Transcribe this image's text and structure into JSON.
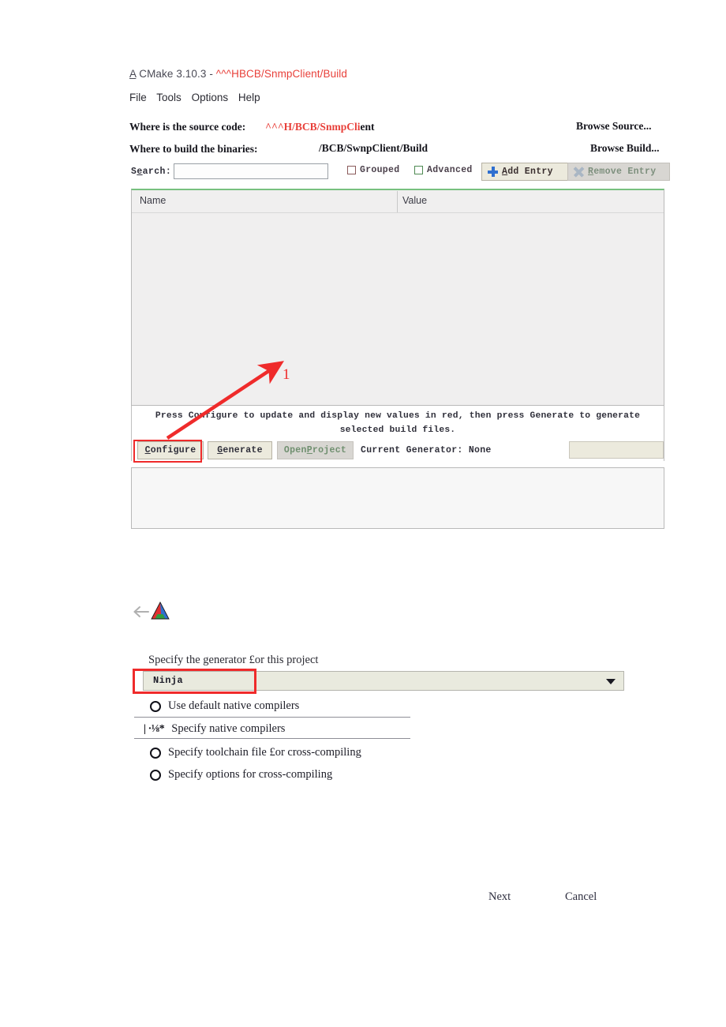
{
  "window": {
    "app_icon": "A",
    "title": "CMake 3.10.3 -",
    "title_path": "^^^HBCB/SnmpClient/Build",
    "menu": [
      "File",
      "Tools",
      "Options",
      "Help"
    ]
  },
  "paths": {
    "source_label": "Where is the source code:",
    "source_value_red": "^^^H/BCB/SnmpCli",
    "source_value_black": "ent",
    "browse_source_label": "Browse Source...",
    "build_label": "Where to build the binaries:",
    "build_value": "/BCB/SwnpClient/Build",
    "browse_build_label": "Browse Build..."
  },
  "toolbar": {
    "search_label": "Search:",
    "search_value": "",
    "search_placeholder": "",
    "grouped_label": "Grouped",
    "grouped_checked": false,
    "advanced_label": "Advanced",
    "advanced_checked": false,
    "add_entry_label_u": "A",
    "add_entry_label_rest": "dd Entry",
    "remove_entry_label_u": "R",
    "remove_entry_label_rest": "emove Entry"
  },
  "cache_table": {
    "columns": [
      "Name",
      "Value"
    ],
    "rows": []
  },
  "hint": {
    "line1": "Press Configure to update and display new values in red, then press Generate to generate selected",
    "line2": "build files."
  },
  "actions": {
    "configure_u": "C",
    "configure_rest": "onfigure",
    "generate_u": "G",
    "generate_rest": "enerate",
    "open_project_a": "Open ",
    "open_project_u": "P",
    "open_project_rest": "roject",
    "current_generator": "Current Generator: None"
  },
  "annotation": {
    "number": "1",
    "arrow_color": "#ef2b2b",
    "highlight_color": "#ef2b2b"
  },
  "wizard": {
    "prompt": "Specify the generator £or this project",
    "generator_value": "Ninja",
    "options": [
      {
        "label": "Use default native compilers",
        "glyph": "circle",
        "selected": false
      },
      {
        "label": "Specify native compilers",
        "glyph": "| ·⅛*",
        "selected": true
      },
      {
        "label": "Specify toolchain file £or cross-compiling",
        "glyph": "circle",
        "selected": false
      },
      {
        "label": "Specify options for cross-compiling",
        "glyph": "circle",
        "selected": false
      }
    ],
    "next_label": "Next",
    "cancel_label": "Cancel"
  }
}
